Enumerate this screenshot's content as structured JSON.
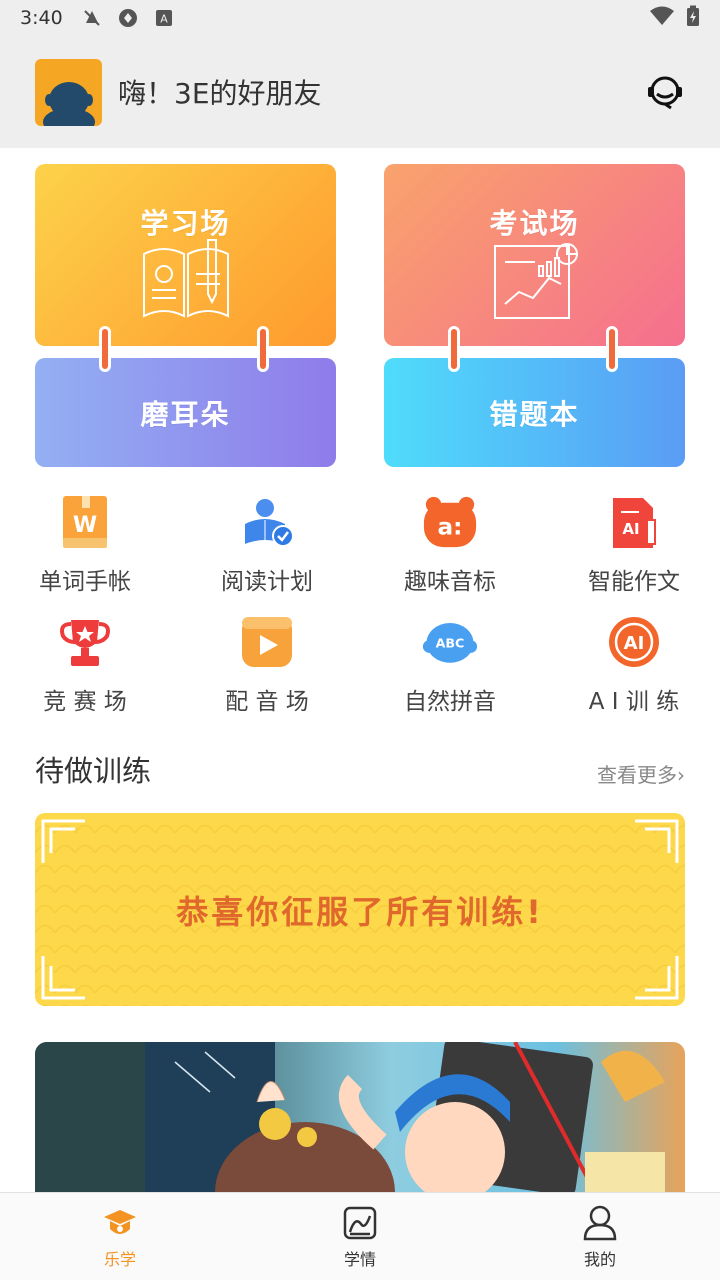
{
  "status_bar": {
    "time": "3:40"
  },
  "header": {
    "greeting": "嗨！3E的好朋友"
  },
  "cards": {
    "study": "学习场",
    "exam": "考试场",
    "listen": "磨耳朵",
    "mistakes": "错题本"
  },
  "grid": [
    {
      "label": "单词手帐",
      "icon": "word-notebook-icon"
    },
    {
      "label": "阅读计划",
      "icon": "reading-plan-icon"
    },
    {
      "label": "趣味音标",
      "icon": "phonetics-icon"
    },
    {
      "label": "智能作文",
      "icon": "ai-essay-icon"
    },
    {
      "label": "竞 赛 场",
      "icon": "trophy-icon"
    },
    {
      "label": "配 音 场",
      "icon": "dubbing-icon"
    },
    {
      "label": "自然拼音",
      "icon": "phonics-abc-icon"
    },
    {
      "label": "A I 训 练",
      "icon": "ai-training-icon"
    }
  ],
  "todo": {
    "title": "待做训练",
    "more": "查看更多",
    "banner_text": "恭喜你征服了所有训练!"
  },
  "tabs": [
    {
      "label": "乐学",
      "icon": "graduation-cap-icon",
      "active": true
    },
    {
      "label": "学情",
      "icon": "chart-icon",
      "active": false
    },
    {
      "label": "我的",
      "icon": "user-icon",
      "active": false
    }
  ],
  "colors": {
    "accent": "#f39321",
    "study_gradient": [
      "#fdd24a",
      "#fe9a2e"
    ],
    "exam_gradient": [
      "#f9a36c",
      "#f56f8e"
    ],
    "listen_gradient": [
      "#93b0f3",
      "#8f7cea"
    ],
    "mistakes_gradient": [
      "#4fdcfb",
      "#5a9cf5"
    ],
    "banner_bg": "#fcd84a",
    "banner_text": "#e0682c"
  }
}
